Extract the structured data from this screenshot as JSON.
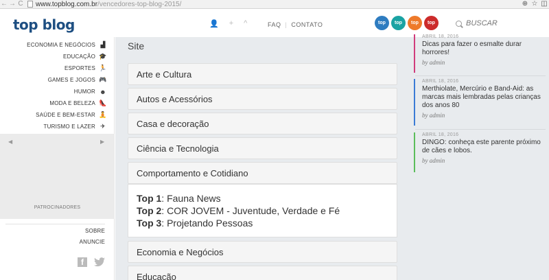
{
  "browser": {
    "back": "←",
    "forward": "→",
    "reload": "C",
    "url_domain": "www.topblog.com.br",
    "url_path": "/vencedores-top-blog-2015/",
    "zoom_icon": "⊕",
    "star_icon": "☆",
    "ext_icon": "◫"
  },
  "header": {
    "logo": "top blog",
    "icons": [
      "user-icon",
      "plus-icon",
      "chevron-up-icon"
    ],
    "icon_glyphs": [
      "👤",
      "+",
      "^"
    ],
    "links": [
      "FAQ",
      "CONTATO"
    ],
    "badges": [
      {
        "label": "top",
        "color": "#2e7cc0"
      },
      {
        "label": "top",
        "color": "#1aa3a3"
      },
      {
        "label": "top",
        "color": "#ee7a2a"
      },
      {
        "label": "top",
        "color": "#cc2b2b"
      }
    ],
    "search_placeholder": "BUSCAR"
  },
  "sidebar": {
    "categories": [
      {
        "label": "ECONOMIA E NEGÓCIOS",
        "icon": "chart-icon",
        "glyph": "▟",
        "accent": "#3a7bd5"
      },
      {
        "label": "EDUCAÇÃO",
        "icon": "graduation-cap-icon",
        "glyph": "🎓",
        "accent": "#5bbd5b"
      },
      {
        "label": "ESPORTES",
        "icon": "runner-icon",
        "glyph": "🏃",
        "accent": "#1aa3a3"
      },
      {
        "label": "GAMES E JOGOS",
        "icon": "gamepad-icon",
        "glyph": "🎮",
        "accent": "#9b59b6"
      },
      {
        "label": "HUMOR",
        "icon": "smiley-icon",
        "glyph": "☻",
        "accent": "#e07a2a"
      },
      {
        "label": "MODA E BELEZA",
        "icon": "high-heel-icon",
        "glyph": "👠",
        "accent": "#d03c7c"
      },
      {
        "label": "SAÚDE E BEM-ESTAR",
        "icon": "meditation-icon",
        "glyph": "🧘",
        "accent": "#3a7bd5"
      },
      {
        "label": "TURISMO E LAZER",
        "icon": "airplane-icon",
        "glyph": "✈",
        "accent": "#5bbd5b"
      }
    ],
    "sponsors_label": "PATROCINADORES",
    "prev": "◀",
    "next": "▶",
    "footer_links": [
      "SOBRE",
      "ANUNCIE"
    ]
  },
  "main": {
    "section_title": "Site",
    "categories": [
      "Arte e Cultura",
      "Autos e Acessórios",
      "Casa e decoração",
      "Ciência e Tecnologia",
      "Comportamento e Cotidiano"
    ],
    "open_category": {
      "items": [
        {
          "rank": "Top 1",
          "name": "Fauna News"
        },
        {
          "rank": "Top 2",
          "name": "COR JOVEM - Juventude, Verdade e Fé"
        },
        {
          "rank": "Top 3",
          "name": "Projetando Pessoas"
        }
      ]
    },
    "categories_after": [
      "Economia e Negócios",
      "Educação"
    ]
  },
  "right": {
    "posts": [
      {
        "date": "ABRIL 18, 2016",
        "title": "Dicas para fazer o esmalte durar horrores!",
        "by": "by admin",
        "color": "#d03c7c"
      },
      {
        "date": "ABRIL 18, 2016",
        "title": "Merthiolate, Mercúrio e Band-Aid: as marcas mais lembradas pelas crianças dos anos 80",
        "by": "by admin",
        "color": "#3a7bd5"
      },
      {
        "date": "ABRIL 18, 2016",
        "title": "DINGO: conheça este parente próximo de cães e lobos.",
        "by": "by admin",
        "color": "#5bbd5b"
      }
    ]
  }
}
